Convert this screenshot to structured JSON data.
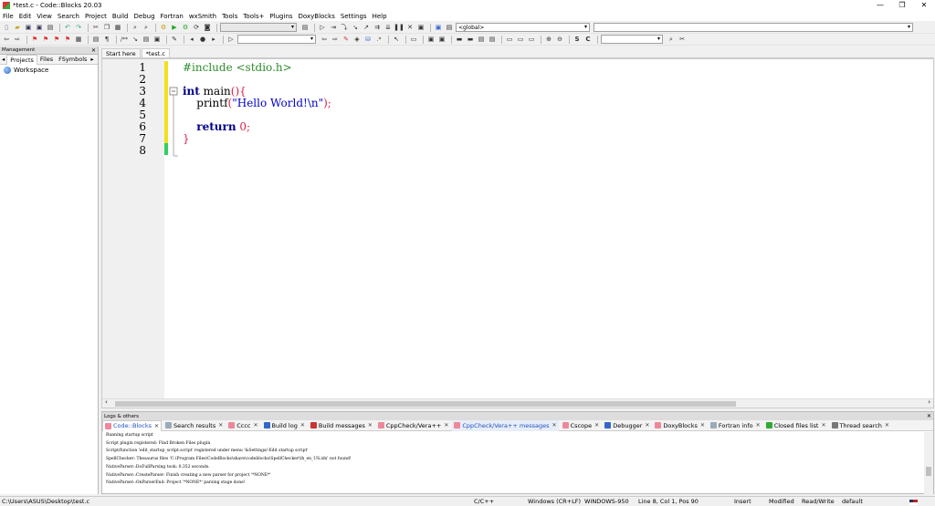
{
  "window": {
    "title": "*test.c - Code::Blocks 20.03",
    "min": "—",
    "max": "❐",
    "close": "✕"
  },
  "menu": [
    "File",
    "Edit",
    "View",
    "Search",
    "Project",
    "Build",
    "Debug",
    "Fortran",
    "wxSmith",
    "Tools",
    "Tools+",
    "Plugins",
    "DoxyBlocks",
    "Settings",
    "Help"
  ],
  "toolbar": {
    "scope_combo": "<global>",
    "function_combo": ""
  },
  "management": {
    "title": "Management",
    "tabs": [
      "Projects",
      "Files",
      "FSymbols"
    ],
    "workspace": "Workspace"
  },
  "editor": {
    "tabs": [
      "Start here",
      "*test.c"
    ],
    "line_numbers": [
      "1",
      "2",
      "3",
      "4",
      "5",
      "6",
      "7",
      "8"
    ]
  },
  "logs": {
    "title": "Logs & others",
    "tabs": [
      "Code::Blocks",
      "Search results",
      "Cccc",
      "Build log",
      "Build messages",
      "CppCheck/Vera++",
      "CppCheck/Vera++ messages",
      "Cscope",
      "Debugger",
      "DoxyBlocks",
      "Fortran info",
      "Closed files list",
      "Thread search"
    ],
    "lines": [
      "Running startup script",
      "Script plugin registered: Find Broken Files plugin",
      "Script/function 'edit_startup_script.script' registered under menu '&Settings/-Edit startup script'",
      "SpellChecker: Thesaurus files 'C:\\Program Files\\CodeBlocks\\share\\codeblocks\\SpellChecker\\th_en_US.idx' not found!",
      "NativeParser::DoFullParsing took: 0.352 seconds.",
      "NativeParser::CreateParser: Finish creating a new parser for project '*NONE*'",
      "NativeParser::OnParserEnd: Project '*NONE*' parsing stage done!"
    ]
  },
  "status": {
    "path": "C:\\Users\\ASUS\\Desktop\\test.c",
    "lang": "C/C++",
    "eol": "Windows (CR+LF)",
    "encoding": "WINDOWS-950",
    "position": "Line 8, Col 1, Pos 90",
    "insert": "Insert",
    "modified": "Modified",
    "rw": "Read/Write",
    "profile": "default"
  },
  "colors": {
    "changed_line": "#f2e11c",
    "saved_line": "#30d060",
    "preprocessor": "#2e8b2e",
    "keyword": "#00008b",
    "string": "#0000cd",
    "operator": "#e0204a"
  }
}
